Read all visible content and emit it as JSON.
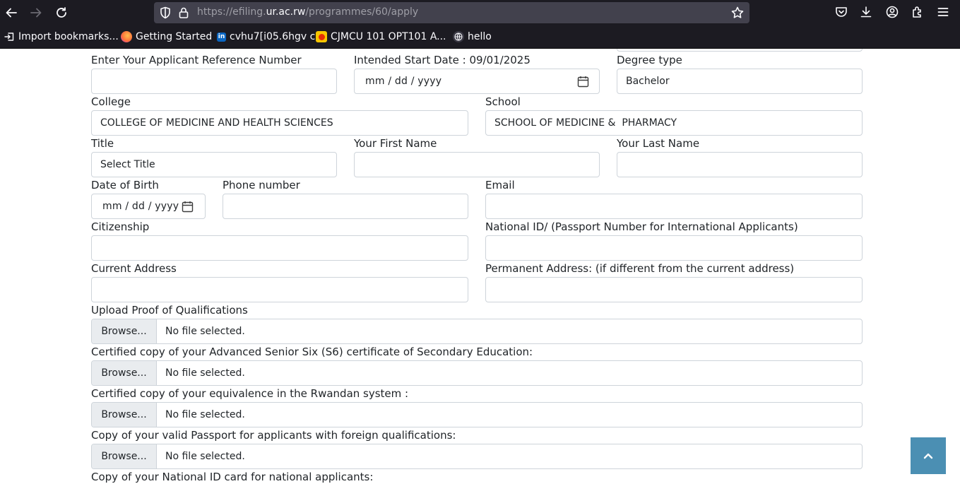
{
  "browser": {
    "url_prefix": "https://efiling.",
    "url_host": "ur.ac.rw",
    "url_path": "/programmes/60/apply",
    "bookmarks": [
      {
        "label": "Import bookmarks...",
        "icon": "import-icon"
      },
      {
        "label": "Getting Started",
        "icon": "firefox-icon"
      },
      {
        "label": "cvhu7[i05.6hgv c",
        "icon": "linkedin-icon"
      },
      {
        "label": "CJMCU 101 OPT101 A...",
        "icon": "aliexpress-icon"
      },
      {
        "label": "hello",
        "icon": "globe-icon"
      }
    ]
  },
  "form": {
    "ref_label": "Enter Your Applicant Reference Number",
    "ref_value": "",
    "start_label": "Intended Start Date : 09/01/2025",
    "start_placeholder": "mm / dd / yyyy",
    "degree_label": "Degree type",
    "degree_value": "Bachelor",
    "college_label": "College",
    "college_value": "COLLEGE OF MEDICINE AND HEALTH SCIENCES",
    "school_label": "School",
    "school_value": "SCHOOL OF MEDICINE &  PHARMACY",
    "title_label": "Title",
    "title_value": "Select Title",
    "first_name_label": "Your First Name",
    "last_name_label": "Your Last Name",
    "dob_label": "Date of Birth",
    "dob_placeholder": "mm / dd / yyyy",
    "phone_label": "Phone number",
    "email_label": "Email",
    "citizenship_label": "Citizenship",
    "national_id_label": "National ID/ (Passport Number for International Applicants)",
    "current_address_label": "Current Address",
    "permanent_address_label": "Permanent Address: (if different from the current address)",
    "browse_label": "Browse...",
    "no_file_text": "No file selected.",
    "uploads": [
      {
        "label": "Upload Proof of Qualifications"
      },
      {
        "label": "Certified copy of your Advanced Senior Six (S6) certificate of Secondary Education:"
      },
      {
        "label": "Certified copy of your equivalence in the Rwandan system :"
      },
      {
        "label": "Copy of your valid Passport for applicants with foreign qualifications:"
      },
      {
        "label": "Copy of your National ID card for national applicants:"
      }
    ]
  },
  "colors": {
    "chrome_bg": "#1c1b22",
    "urlbar_bg": "#42414d",
    "input_border": "#ced4da",
    "browse_bg": "#e9ecef",
    "back_to_top_bg": "#4b8fb3"
  }
}
